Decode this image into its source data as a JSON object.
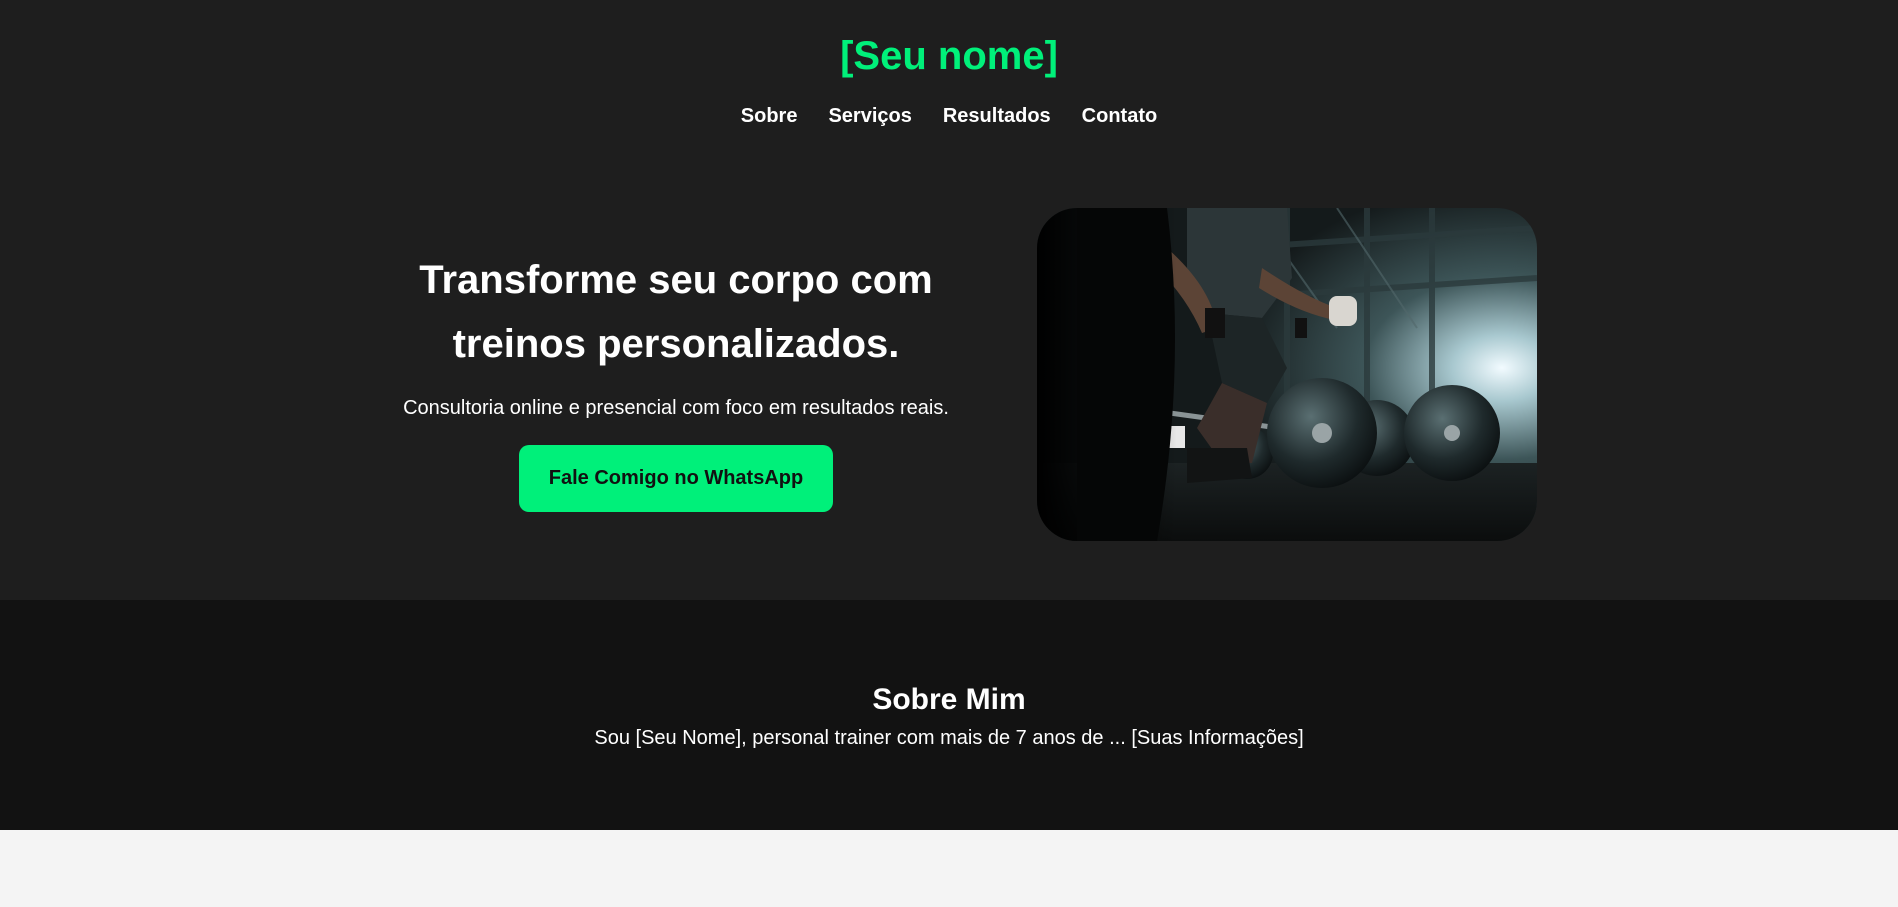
{
  "header": {
    "brand": "[Seu nome]",
    "nav": [
      "Sobre",
      "Serviços",
      "Resultados",
      "Contato"
    ]
  },
  "hero": {
    "title": "Transforme seu corpo com treinos personalizados.",
    "subtitle": "Consultoria online e presencial com foco em resultados reais.",
    "cta_label": "Fale Comigo no WhatsApp",
    "image_icon": "gym-deadlift-photo"
  },
  "about": {
    "title": "Sobre Mim",
    "text": "Sou [Seu Nome], personal trainer com mais de 7 anos de ... [Suas Informações]"
  },
  "colors": {
    "accent": "#00f07a",
    "header_bg": "#1e1e1e",
    "about_bg": "#121212",
    "page_bg": "#f4f4f4"
  }
}
